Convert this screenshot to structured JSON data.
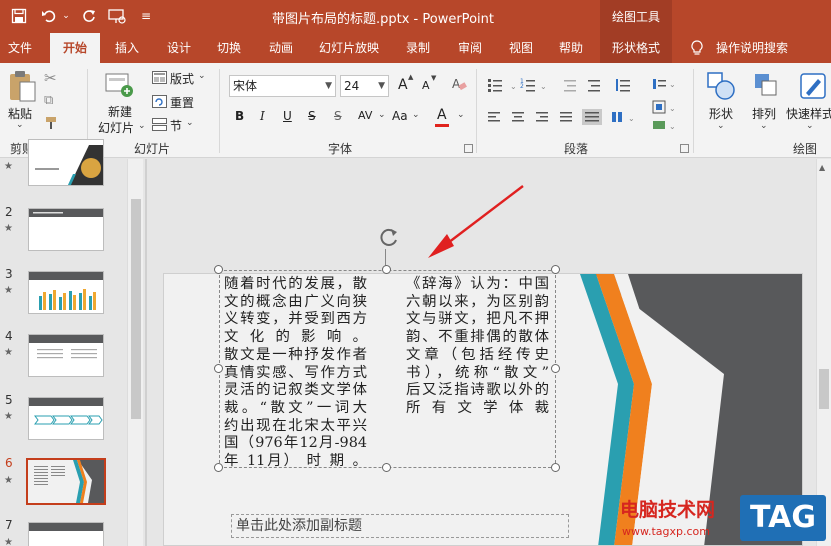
{
  "titlebar": {
    "doc_title": "带图片布局的标题.pptx  -  PowerPoint",
    "context_group": "绘图工具"
  },
  "tabs": [
    "文件",
    "开始",
    "插入",
    "设计",
    "切换",
    "动画",
    "幻灯片放映",
    "录制",
    "审阅",
    "视图",
    "帮助",
    "形状格式"
  ],
  "active_tab": "开始",
  "tell_me": "操作说明搜索",
  "ribbon": {
    "clipboard": {
      "paste": "粘贴",
      "label": "剪贴板"
    },
    "slides": {
      "new_slide_line1": "新建",
      "new_slide_line2": "幻灯片",
      "layout": "版式",
      "reset": "重置",
      "section": "节",
      "label": "幻灯片"
    },
    "font": {
      "name": "宋体",
      "size": "24",
      "bold": "B",
      "italic": "I",
      "underline": "U",
      "strike": "S",
      "spacing": "AV",
      "case": "Aa",
      "color": "A",
      "grow": "A",
      "shrink": "A",
      "label": "字体"
    },
    "paragraph": {
      "label": "段落"
    },
    "drawing": {
      "shapes": "形状",
      "arrange": "排列",
      "quick_styles": "快速样式",
      "label": "绘图"
    }
  },
  "slides_panel": {
    "thumbnails": [
      {
        "number": "2"
      },
      {
        "number": "3"
      },
      {
        "number": "4"
      },
      {
        "number": "5"
      },
      {
        "number": "6"
      },
      {
        "number": "7"
      }
    ],
    "current": "6"
  },
  "slide": {
    "left_column": [
      "随着时代的发展，散",
      "文的概念由广义向狭",
      "义转变，并受到西方",
      "文 化 的 影 响 。",
      "散文是一种抒发作者",
      "真情实感、写作方式",
      "灵活的记叙类文学体",
      "裁。“散文”一词大",
      "约出现在北宋太平兴",
      "国（976年12月-984",
      "年 11月） 时 期 。"
    ],
    "right_column": [
      "《辞海》认为：中国",
      "六朝以来，为区别韵",
      "文与骈文，把凡不押",
      "韵、不重排偶的散体",
      "文章（包括经传史",
      "书），统称“散文”",
      "后又泛指诗歌以外的",
      "所 有 文 学 体 裁"
    ],
    "subtitle_placeholder": "单击此处添加副标题"
  },
  "watermark": {
    "text": "电脑技术网",
    "url": "www.tagxp.com",
    "badge": "TAG"
  },
  "colors": {
    "accent": "#b7472a",
    "context_tab": "#a23d25",
    "slide_dark": "#58595b",
    "stripe_teal": "#2a9fb0",
    "stripe_orange": "#f0801e",
    "annotation_arrow": "#e02020"
  }
}
